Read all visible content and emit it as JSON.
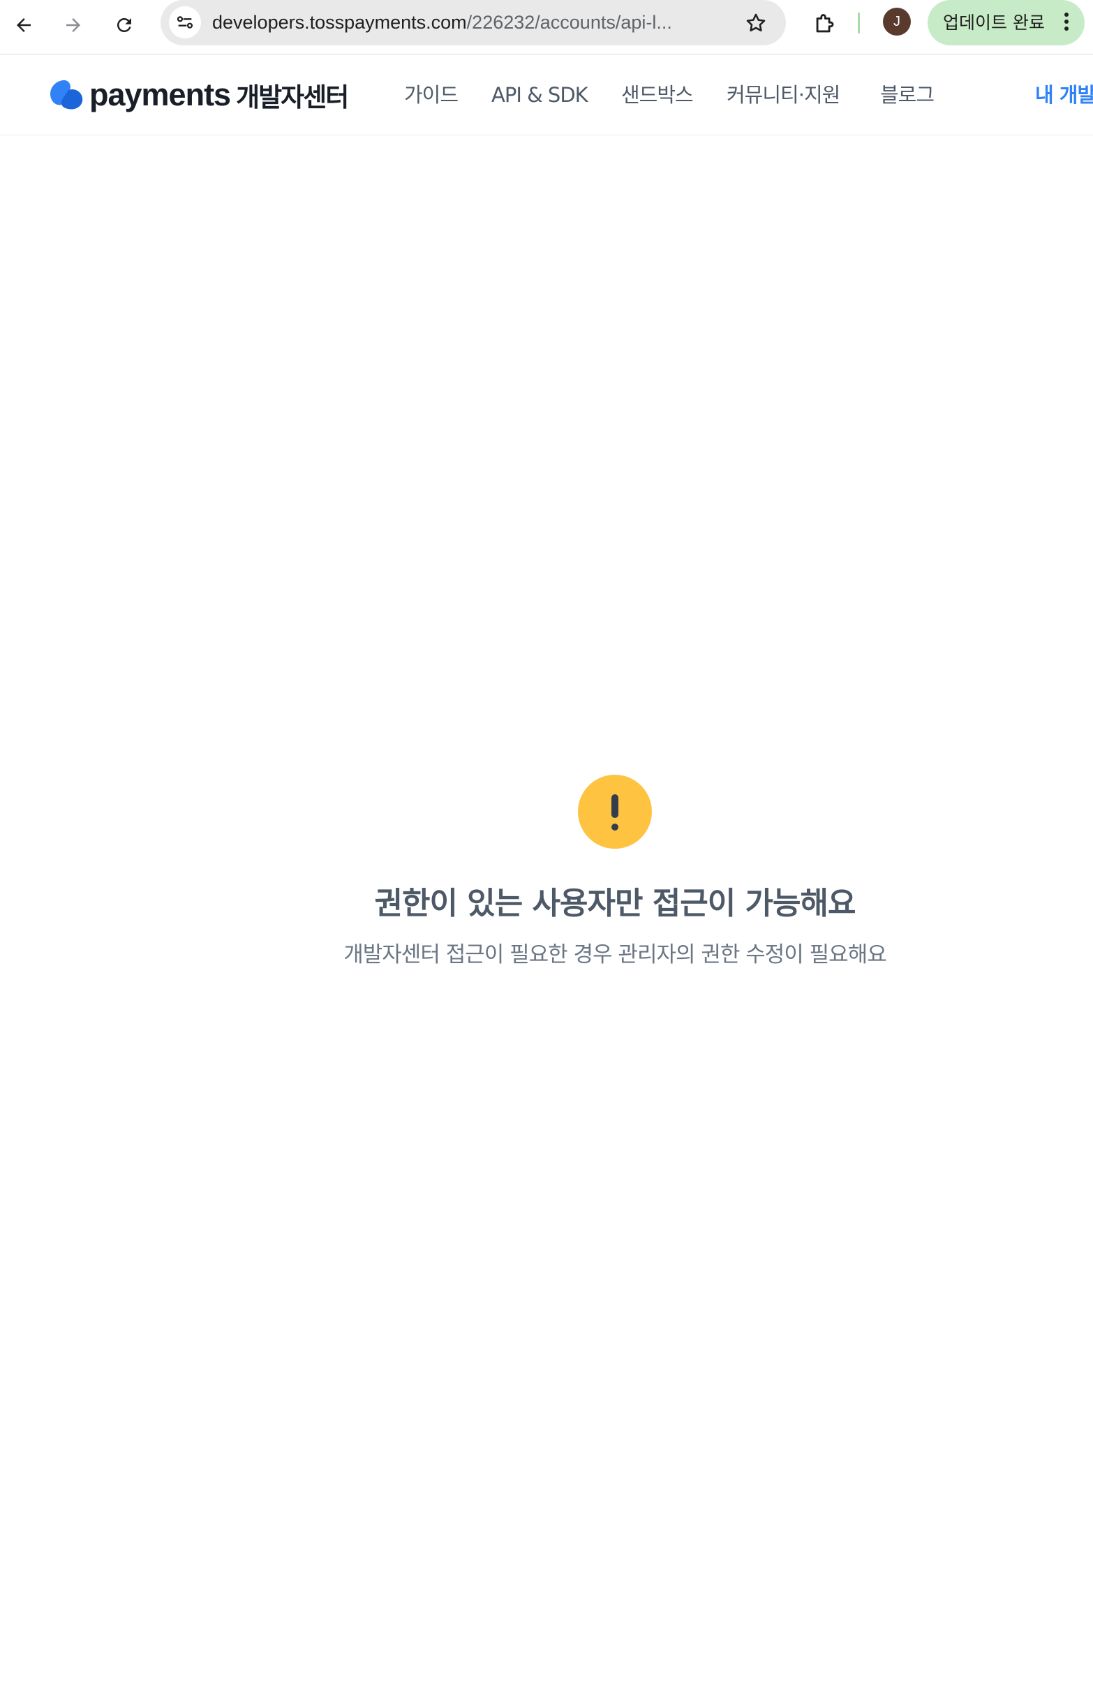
{
  "browser": {
    "url_host": "developers.tosspayments.com",
    "url_path": "/226232/accounts/api-l...",
    "profile_initial": "J",
    "update_label": "업데이트 완료"
  },
  "site": {
    "logo_word": "payments",
    "logo_sub": "개발자센터",
    "nav": [
      "가이드",
      "API & SDK",
      "샌드박스",
      "커뮤니티·지원",
      "블로그",
      "내 개발"
    ]
  },
  "notice": {
    "icon": "exclamation-icon",
    "title": "권한이 있는 사용자만 접근이 가능해요",
    "description": "개발자센터 접근이 필요한 경우 관리자의 권한 수정이 필요해요"
  },
  "colors": {
    "brand_blue": "#3182f6",
    "warning_yellow": "#ffc342",
    "update_green": "#c7ebc6"
  }
}
